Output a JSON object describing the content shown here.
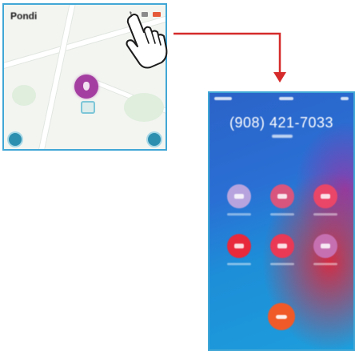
{
  "map_screen": {
    "title": "Pondi",
    "top_icons": [
      "phone-icon",
      "message-icon",
      "settings-icon"
    ],
    "accent": "#41a7d6",
    "pin_color": "#a43fa1"
  },
  "call_screen": {
    "phone_number": "(908) 421-7033",
    "buttons": [
      {
        "icon": "mute-icon",
        "color": "#b7a4de"
      },
      {
        "icon": "keypad-icon",
        "color": "#d8557d"
      },
      {
        "icon": "speaker-icon",
        "color": "#ea4668"
      },
      {
        "icon": "add-call-icon",
        "color": "#e8283b"
      },
      {
        "icon": "facetime-icon",
        "color": "#e93955"
      },
      {
        "icon": "contacts-icon",
        "color": "#c670b2"
      }
    ],
    "end_call_color": "#f05a28"
  },
  "annotation": {
    "arrow_color": "#d62b2b"
  }
}
